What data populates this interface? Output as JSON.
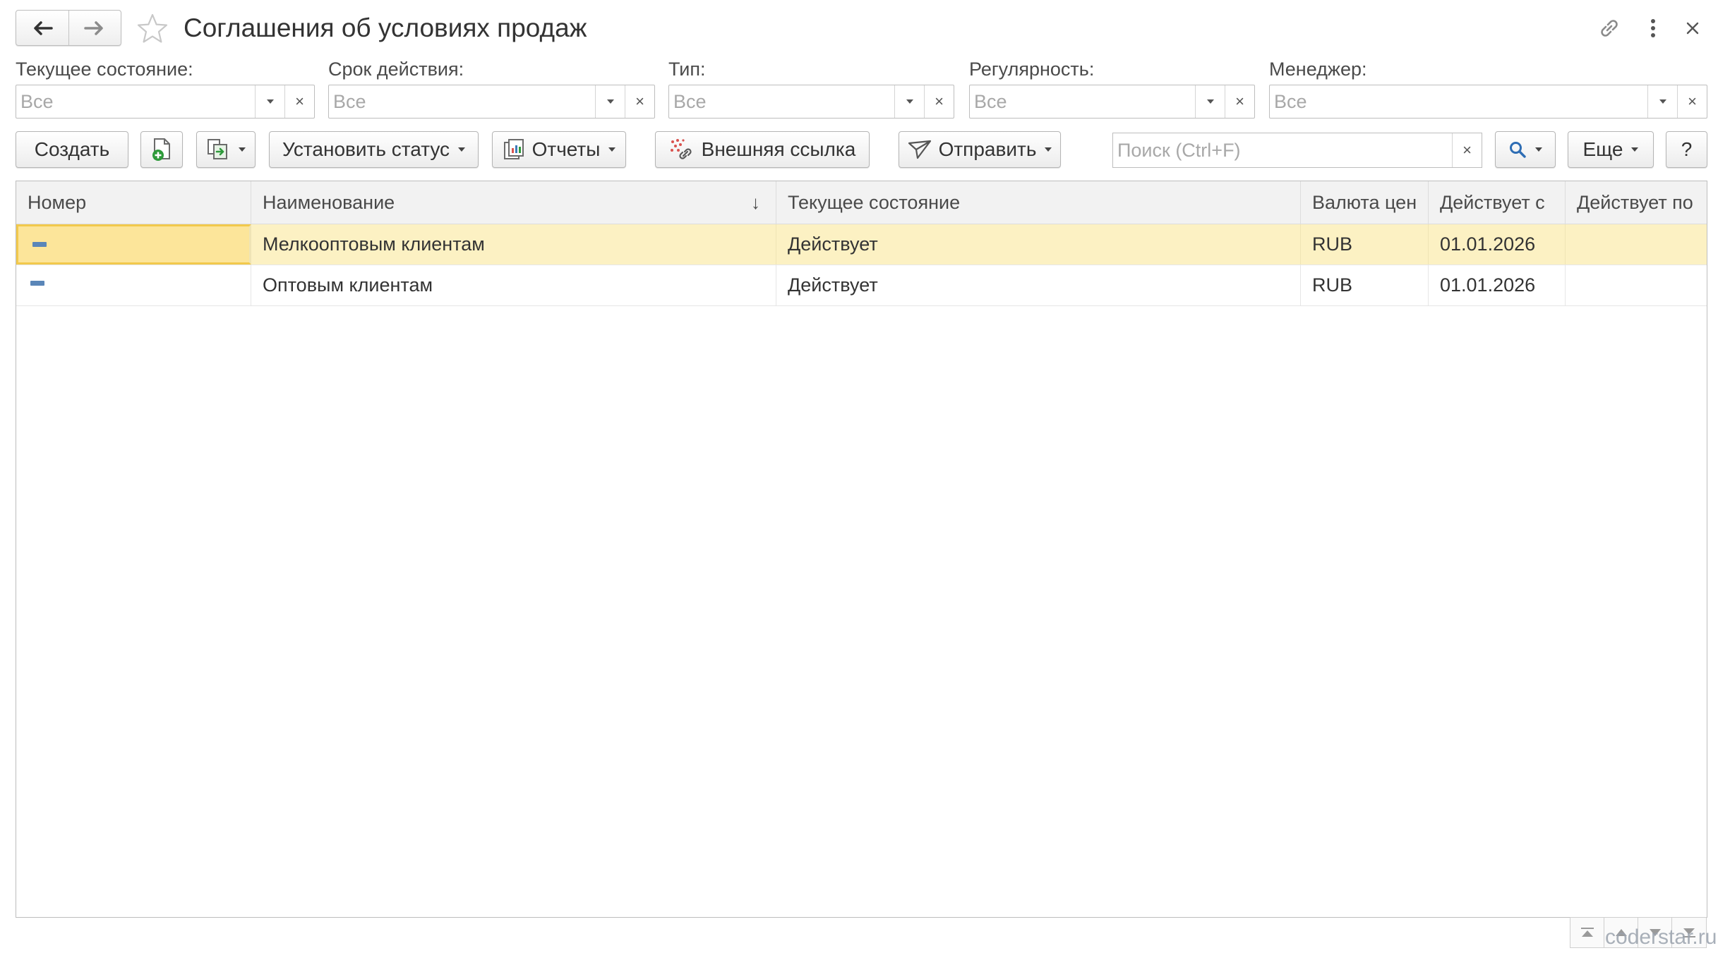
{
  "header": {
    "title": "Соглашения об условиях продаж",
    "icons": {
      "back": "arrow-left-icon",
      "forward": "arrow-right-icon",
      "favorite": "star-icon",
      "link": "link-icon",
      "more": "more-vertical-icon",
      "close": "close-icon"
    }
  },
  "filters": [
    {
      "label": "Текущее состояние:",
      "value": "Все"
    },
    {
      "label": "Срок действия:",
      "value": "Все"
    },
    {
      "label": "Тип:",
      "value": "Все"
    },
    {
      "label": "Регулярность:",
      "value": "Все"
    },
    {
      "label": "Менеджер:",
      "value": "Все"
    }
  ],
  "toolbar": {
    "create_label": "Создать",
    "set_status_label": "Установить статус",
    "reports_label": "Отчеты",
    "external_link_label": "Внешняя ссылка",
    "send_label": "Отправить",
    "search_placeholder": "Поиск (Ctrl+F)",
    "more_label": "Еще",
    "help_label": "?"
  },
  "table": {
    "columns": [
      "Номер",
      "Наименование",
      "Текущее состояние",
      "Валюта цен",
      "Действует с",
      "Действует по"
    ],
    "sort_indicator": "↓",
    "rows": [
      {
        "number": "",
        "name": "Мелкооптовым клиентам",
        "state": "Действует",
        "currency": "RUB",
        "valid_from": "01.01.2026",
        "valid_to": ""
      },
      {
        "number": "",
        "name": "Оптовым клиентам",
        "state": "Действует",
        "currency": "RUB",
        "valid_from": "01.01.2026",
        "valid_to": ""
      }
    ]
  },
  "colors": {
    "selected_row": "#fcf1c3",
    "selected_cell": "#fce59a",
    "selected_border": "#f2c94c",
    "status_marker": "#5a86b8",
    "add_icon_green": "#2e9a3a"
  },
  "watermark": "coderstar.ru"
}
